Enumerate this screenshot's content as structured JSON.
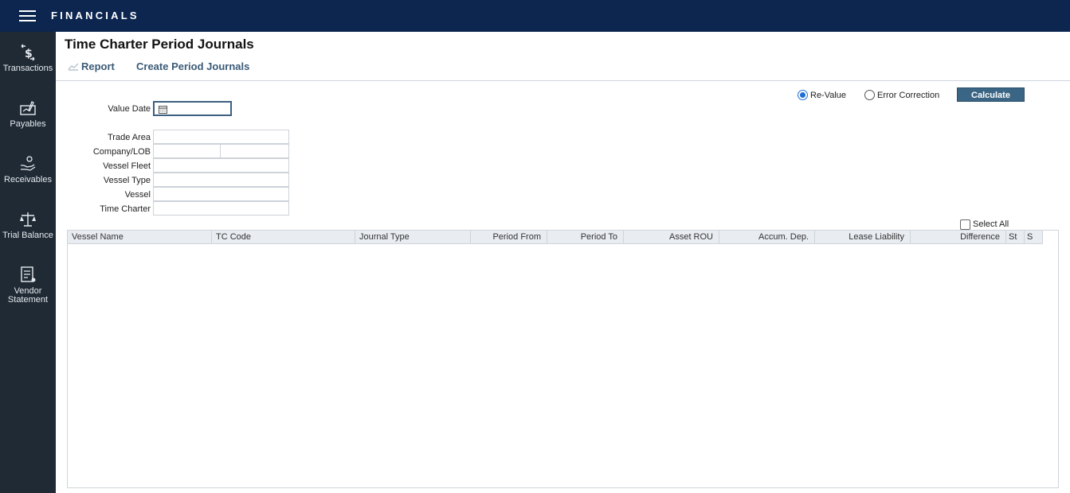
{
  "app": {
    "title": "FINANCIALS"
  },
  "sidebar": {
    "items": [
      {
        "label": "Transactions",
        "icon": "dollar-transfer-icon"
      },
      {
        "label": "Payables",
        "icon": "check-sign-icon"
      },
      {
        "label": "Receivables",
        "icon": "hand-coins-icon"
      },
      {
        "label": "Trial Balance",
        "icon": "scales-icon"
      },
      {
        "label": "Vendor Statement",
        "icon": "statement-icon"
      }
    ]
  },
  "header": {
    "page_title": "Time Charter Period Journals",
    "report_label": "Report",
    "create_label": "Create Period Journals"
  },
  "form": {
    "value_date_label": "Value Date",
    "value_date": "",
    "trade_area_label": "Trade Area",
    "company_lob_label": "Company/LOB",
    "vessel_fleet_label": "Vessel Fleet",
    "vessel_type_label": "Vessel Type",
    "vessel_label": "Vessel",
    "time_charter_label": "Time Charter"
  },
  "options": {
    "revalue_label": "Re-Value",
    "error_correction_label": "Error Correction",
    "selected": "Re-Value",
    "calculate_label": "Calculate",
    "select_all_label": "Select All"
  },
  "grid": {
    "columns": [
      "Vessel Name",
      "TC Code",
      "Journal Type",
      "Period From",
      "Period To",
      "Asset ROU",
      "Accum. Dep.",
      "Lease Liability",
      "Difference",
      "St",
      "S"
    ],
    "rows": []
  },
  "colors": {
    "topbar": "#0c2650",
    "sidebar": "#1f2a35",
    "accent": "#3a6584",
    "link": "#3a5a78"
  }
}
